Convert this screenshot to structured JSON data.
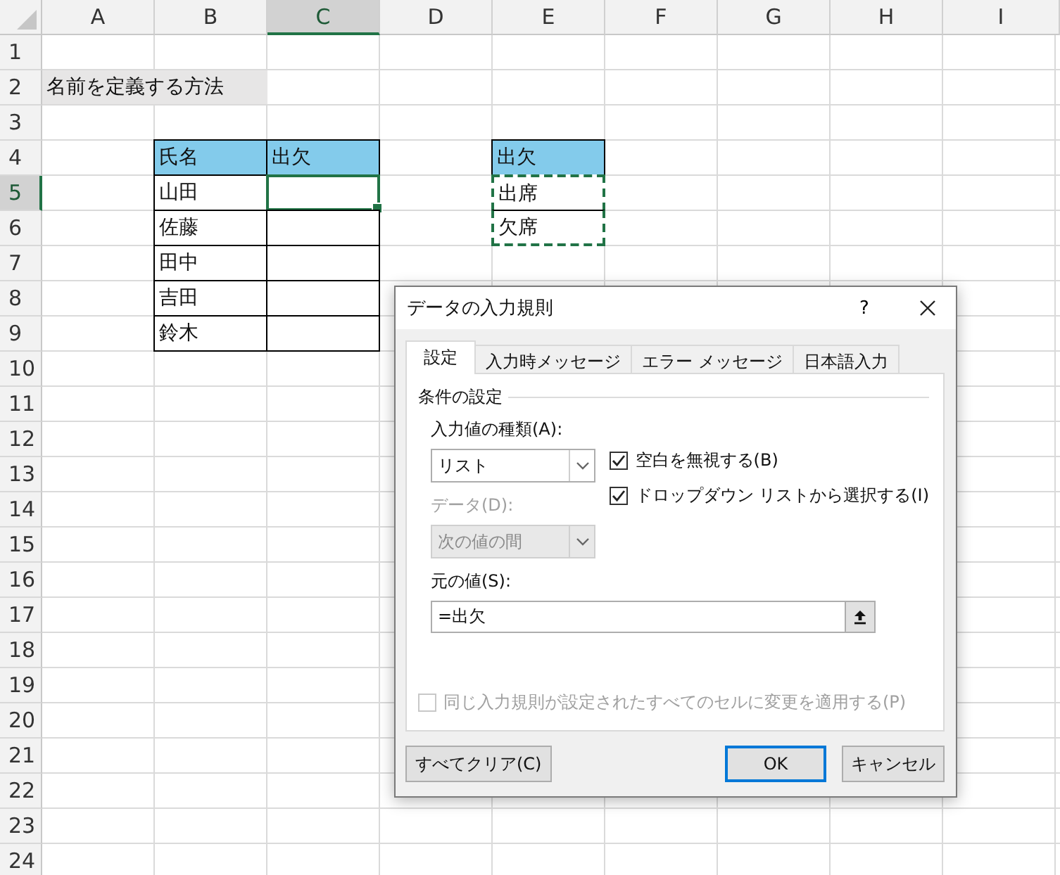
{
  "spreadsheet": {
    "columns": [
      {
        "label": "A",
        "selected": false
      },
      {
        "label": "B",
        "selected": false
      },
      {
        "label": "C",
        "selected": true
      },
      {
        "label": "D",
        "selected": false
      },
      {
        "label": "E",
        "selected": false
      },
      {
        "label": "F",
        "selected": false
      },
      {
        "label": "G",
        "selected": false
      },
      {
        "label": "H",
        "selected": false
      },
      {
        "label": "I",
        "selected": false
      }
    ],
    "rows": [
      {
        "label": "1",
        "selected": false
      },
      {
        "label": "2",
        "selected": false,
        "cells": [
          {
            "text": "名前を定義する方法",
            "kind": "title",
            "selected": false,
            "marquee": false
          },
          null,
          null,
          null,
          null,
          null,
          null,
          null,
          null
        ]
      },
      {
        "label": "3",
        "selected": false
      },
      {
        "label": "4",
        "selected": false,
        "cells": [
          null,
          {
            "text": "氏名",
            "kind": "header",
            "selected": false,
            "marquee": false
          },
          {
            "text": "出欠",
            "kind": "header",
            "selected": false,
            "marquee": false
          },
          null,
          {
            "text": "出欠",
            "kind": "header",
            "selected": false,
            "marquee": false
          },
          null,
          null,
          null,
          null
        ]
      },
      {
        "label": "5",
        "selected": true,
        "cells": [
          null,
          {
            "text": "山田",
            "kind": "bordered",
            "selected": false,
            "marquee": false
          },
          {
            "kind": "bordered",
            "selected": true,
            "marquee": false
          },
          null,
          {
            "text": "出席",
            "kind": "bordered",
            "selected": false,
            "marquee": true
          },
          null,
          null,
          null,
          null
        ]
      },
      {
        "label": "6",
        "selected": false,
        "cells": [
          null,
          {
            "text": "佐藤",
            "kind": "bordered",
            "selected": false,
            "marquee": false
          },
          {
            "kind": "bordered",
            "selected": false,
            "marquee": false
          },
          null,
          {
            "text": "欠席",
            "kind": "bordered",
            "selected": false,
            "marquee": true
          },
          null,
          null,
          null,
          null
        ]
      },
      {
        "label": "7",
        "selected": false,
        "cells": [
          null,
          {
            "text": "田中",
            "kind": "bordered",
            "selected": false,
            "marquee": false
          },
          {
            "kind": "bordered",
            "selected": false,
            "marquee": false
          },
          null,
          null,
          null,
          null,
          null,
          null
        ]
      },
      {
        "label": "8",
        "selected": false,
        "cells": [
          null,
          {
            "text": "吉田",
            "kind": "bordered",
            "selected": false,
            "marquee": false
          },
          {
            "kind": "bordered",
            "selected": false,
            "marquee": false
          },
          null,
          null,
          null,
          null,
          null,
          null
        ]
      },
      {
        "label": "9",
        "selected": false,
        "cells": [
          null,
          {
            "text": "鈴木",
            "kind": "bordered",
            "selected": false,
            "marquee": false
          },
          {
            "kind": "bordered",
            "selected": false,
            "marquee": false
          },
          null,
          null,
          null,
          null,
          null,
          null
        ]
      },
      {
        "label": "10",
        "selected": false
      },
      {
        "label": "11",
        "selected": false
      },
      {
        "label": "12",
        "selected": false
      },
      {
        "label": "13",
        "selected": false
      },
      {
        "label": "14",
        "selected": false
      },
      {
        "label": "15",
        "selected": false
      },
      {
        "label": "16",
        "selected": false
      },
      {
        "label": "17",
        "selected": false
      },
      {
        "label": "18",
        "selected": false
      },
      {
        "label": "19",
        "selected": false
      },
      {
        "label": "20",
        "selected": false
      },
      {
        "label": "21",
        "selected": false
      },
      {
        "label": "22",
        "selected": false
      },
      {
        "label": "23",
        "selected": false
      },
      {
        "label": "24",
        "selected": false
      }
    ]
  },
  "dialog": {
    "title": "データの入力規則",
    "help": "?",
    "tabs": [
      {
        "label": "設定",
        "selected": true
      },
      {
        "label": "入力時メッセージ",
        "selected": false
      },
      {
        "label": "エラー メッセージ",
        "selected": false
      },
      {
        "label": "日本語入力",
        "selected": false
      }
    ],
    "group_label": "条件の設定",
    "allow": {
      "label": "入力値の種類(A):",
      "value": "リスト",
      "disabled": false
    },
    "data": {
      "label": "データ(D):",
      "value": "次の値の間",
      "disabled": true
    },
    "options": [
      {
        "label": "空白を無視する(B)",
        "checked": true
      },
      {
        "label": "ドロップダウン リストから選択する(I)",
        "checked": true
      }
    ],
    "source": {
      "label": "元の値(S):",
      "value": "=出欠"
    },
    "apply_all": {
      "label": "同じ入力規則が設定されたすべてのセルに変更を適用する(P)",
      "checked": false,
      "disabled": true
    },
    "buttons": [
      {
        "label": "すべてクリア(C)",
        "kind": "clear"
      },
      {
        "label": "OK",
        "kind": "default"
      },
      {
        "label": "キャンセル",
        "kind": "cancel"
      }
    ]
  }
}
